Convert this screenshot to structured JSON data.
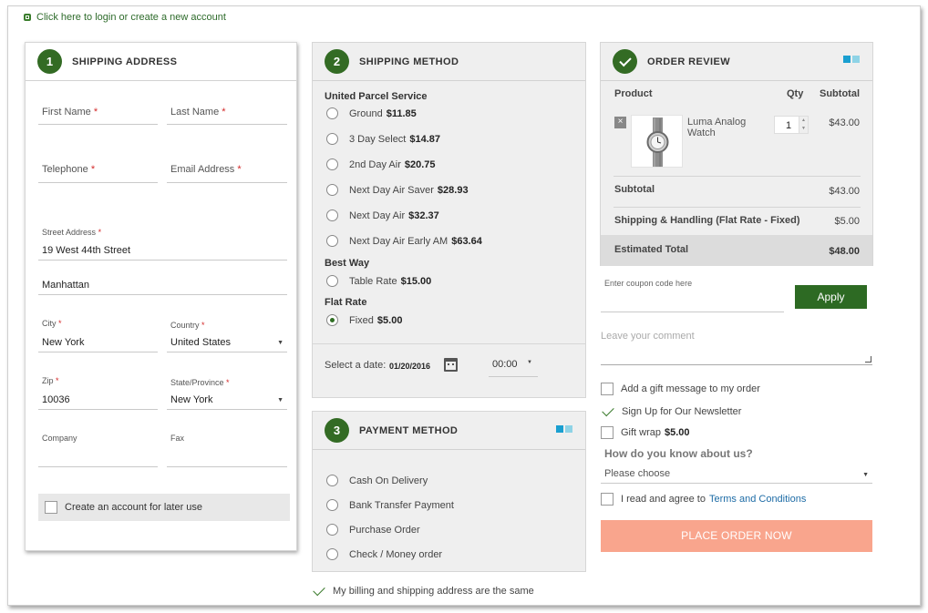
{
  "login_link": "Click here to login or create a new account",
  "shipping_address": {
    "step": "1",
    "title": "SHIPPING ADDRESS",
    "first_name_label": "First Name",
    "last_name_label": "Last Name",
    "telephone_label": "Telephone",
    "email_label": "Email Address",
    "street_label": "Street Address",
    "street_line1": "19 West 44th Street",
    "street_line2": "Manhattan",
    "city_label": "City",
    "city_value": "New York",
    "country_label": "Country",
    "country_value": "United States",
    "zip_label": "Zip",
    "zip_value": "10036",
    "state_label": "State/Province",
    "state_value": "New York",
    "company_label": "Company",
    "fax_label": "Fax",
    "create_account": "Create an account for later use",
    "required_mark": "*"
  },
  "shipping_method": {
    "step": "2",
    "title": "SHIPPING METHOD",
    "groups": [
      {
        "carrier": "United Parcel Service",
        "rates": [
          {
            "label": "Ground",
            "price": "$11.85"
          },
          {
            "label": "3 Day Select",
            "price": "$14.87"
          },
          {
            "label": "2nd Day Air",
            "price": "$20.75"
          },
          {
            "label": "Next Day Air Saver",
            "price": "$28.93"
          },
          {
            "label": "Next Day Air",
            "price": "$32.37"
          },
          {
            "label": "Next Day Air Early AM",
            "price": "$63.64"
          }
        ]
      },
      {
        "carrier": "Best Way",
        "rates": [
          {
            "label": "Table Rate",
            "price": "$15.00"
          }
        ]
      },
      {
        "carrier": "Flat Rate",
        "rates": [
          {
            "label": "Fixed",
            "price": "$5.00"
          }
        ]
      }
    ],
    "date_label": "Select a date:",
    "date_value": "01/20/2016",
    "time_value": "00:00"
  },
  "payment_method": {
    "step": "3",
    "title": "PAYMENT METHOD",
    "options": [
      "Cash On Delivery",
      "Bank Transfer Payment",
      "Purchase Order",
      "Check / Money order"
    ]
  },
  "billing_same": "My billing and shipping address are the same",
  "order_review": {
    "title": "ORDER REVIEW",
    "col_product": "Product",
    "col_qty": "Qty",
    "col_subtotal": "Subtotal",
    "item": {
      "name": "Luma Analog Watch",
      "qty": "1",
      "subtotal": "$43.00",
      "remove": "×"
    },
    "subtotal_label": "Subtotal",
    "subtotal_value": "$43.00",
    "shipping_label": "Shipping & Handling (Flat Rate - Fixed)",
    "shipping_value": "$5.00",
    "total_label": "Estimated Total",
    "total_value": "$48.00"
  },
  "coupon": {
    "placeholder": "Enter coupon code here",
    "apply": "Apply"
  },
  "comment_placeholder": "Leave your comment",
  "gift_message": "Add a gift message to my order",
  "newsletter": "Sign Up for Our Newsletter",
  "gift_wrap": {
    "label": "Gift wrap",
    "price": "$5.00"
  },
  "hear_about": {
    "label": "How do you know about us?",
    "value": "Please choose"
  },
  "terms": {
    "prefix": "I read and agree to",
    "link": "Terms and Conditions"
  },
  "place_order": "PLACE ORDER NOW",
  "colors": {
    "brand_green": "#336b24",
    "place_order": "#f9a58d",
    "link_blue": "#1e6ca6",
    "accent_blue": "#1a9fd0"
  }
}
